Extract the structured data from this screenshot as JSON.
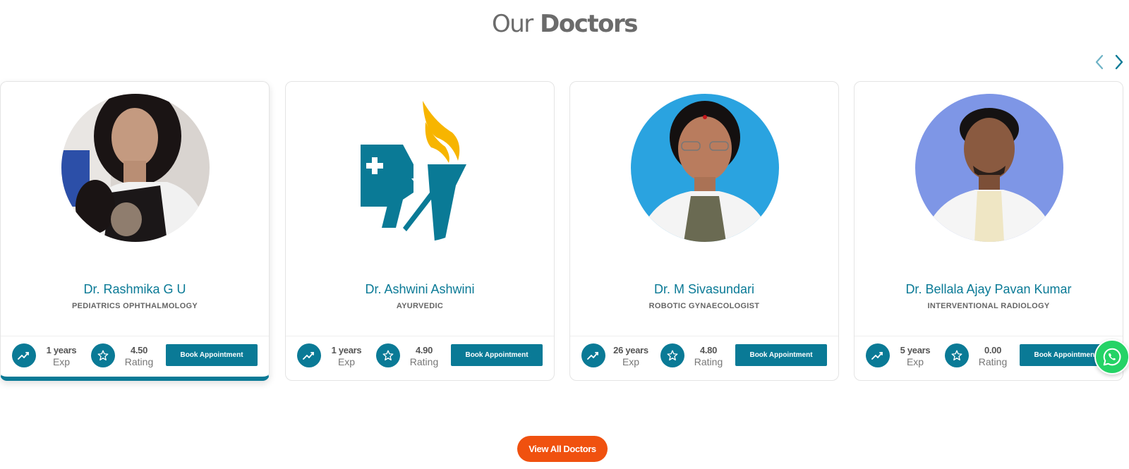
{
  "section": {
    "title_light": "Our",
    "title_bold": "Doctors"
  },
  "carousel": {
    "prev_icon": "chevron-left-icon",
    "next_icon": "chevron-right-icon"
  },
  "doctors": [
    {
      "name": "Dr. Rashmika G U",
      "specialty": "PEDIATRICS OPHTHALMOLOGY",
      "experience": "1 years",
      "experience_label": "Exp",
      "rating": "4.50",
      "rating_label": "Rating",
      "book_label": "Book Appointment",
      "photo": "photo-woman-lab-coat"
    },
    {
      "name": "Dr. Ashwini Ashwini",
      "specialty": "AYURVEDIC",
      "experience": "1 years",
      "experience_label": "Exp",
      "rating": "4.90",
      "rating_label": "Rating",
      "book_label": "Book Appointment",
      "photo": "hospital-logo-placeholder"
    },
    {
      "name": "Dr. M Sivasundari",
      "specialty": "ROBOTIC GYNAECOLOGIST",
      "experience": "26 years",
      "experience_label": "Exp",
      "rating": "4.80",
      "rating_label": "Rating",
      "book_label": "Book Appointment",
      "photo": "photo-woman-blue-bg"
    },
    {
      "name": "Dr. Bellala Ajay Pavan Kumar",
      "specialty": "INTERVENTIONAL RADIOLOGY",
      "experience": "5 years",
      "experience_label": "Exp",
      "rating": "0.00",
      "rating_label": "Rating",
      "book_label": "Book Appointment",
      "photo": "photo-man-purple-bg"
    }
  ],
  "view_all_label": "View All Doctors",
  "whatsapp_icon": "whatsapp-icon",
  "colors": {
    "primary": "#0a7a96",
    "accent": "#f0510f",
    "whatsapp": "#25d366",
    "logo_yellow": "#f7b500"
  }
}
